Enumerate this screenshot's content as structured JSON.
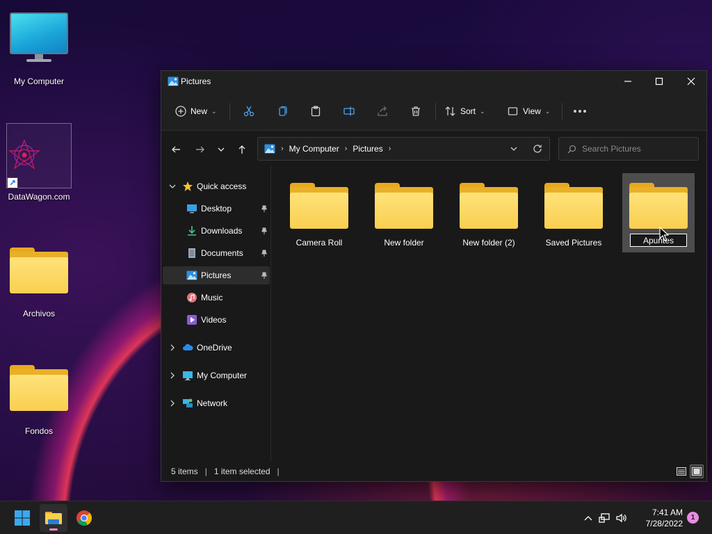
{
  "desktop": {
    "icons": [
      {
        "label": "My Computer",
        "icon": "monitor-icon"
      },
      {
        "label": "DataWagon.com",
        "icon": "datawagon-logo-icon"
      },
      {
        "label": "Archivos",
        "icon": "folder-icon"
      },
      {
        "label": "Fondos",
        "icon": "folder-icon"
      }
    ]
  },
  "window": {
    "title": "Pictures",
    "toolbar": {
      "new_label": "New",
      "sort_label": "Sort",
      "view_label": "View"
    },
    "address": {
      "crumbs": [
        "My Computer",
        "Pictures"
      ]
    },
    "search": {
      "placeholder": "Search Pictures"
    },
    "nav": {
      "quick_access": "Quick access",
      "items": [
        {
          "label": "Desktop",
          "icon": "desktop-icon",
          "pinned": true
        },
        {
          "label": "Downloads",
          "icon": "download-icon",
          "pinned": true
        },
        {
          "label": "Documents",
          "icon": "document-icon",
          "pinned": true
        },
        {
          "label": "Pictures",
          "icon": "pictures-icon",
          "pinned": true
        },
        {
          "label": "Music",
          "icon": "music-icon",
          "pinned": false
        },
        {
          "label": "Videos",
          "icon": "video-icon",
          "pinned": false
        }
      ],
      "roots": [
        {
          "label": "OneDrive",
          "icon": "cloud-icon"
        },
        {
          "label": "My Computer",
          "icon": "monitor-icon"
        },
        {
          "label": "Network",
          "icon": "network-icon"
        }
      ]
    },
    "files": [
      {
        "name": "Camera Roll"
      },
      {
        "name": "New folder"
      },
      {
        "name": "New folder (2)"
      },
      {
        "name": "Saved Pictures"
      },
      {
        "name": "Apuntes",
        "selected": true,
        "renaming": true
      }
    ],
    "status": {
      "count": "5 items",
      "selection": "1 item selected"
    }
  },
  "taskbar": {
    "apps": [
      "start-icon",
      "file-explorer-icon",
      "chrome-icon"
    ],
    "time": "7:41 AM",
    "date": "7/28/2022",
    "notification_count": "1"
  },
  "colors": {
    "folder_yellow": "#f9cf4f",
    "window_bg": "#191919",
    "accent_pink": "#f08ac8"
  }
}
